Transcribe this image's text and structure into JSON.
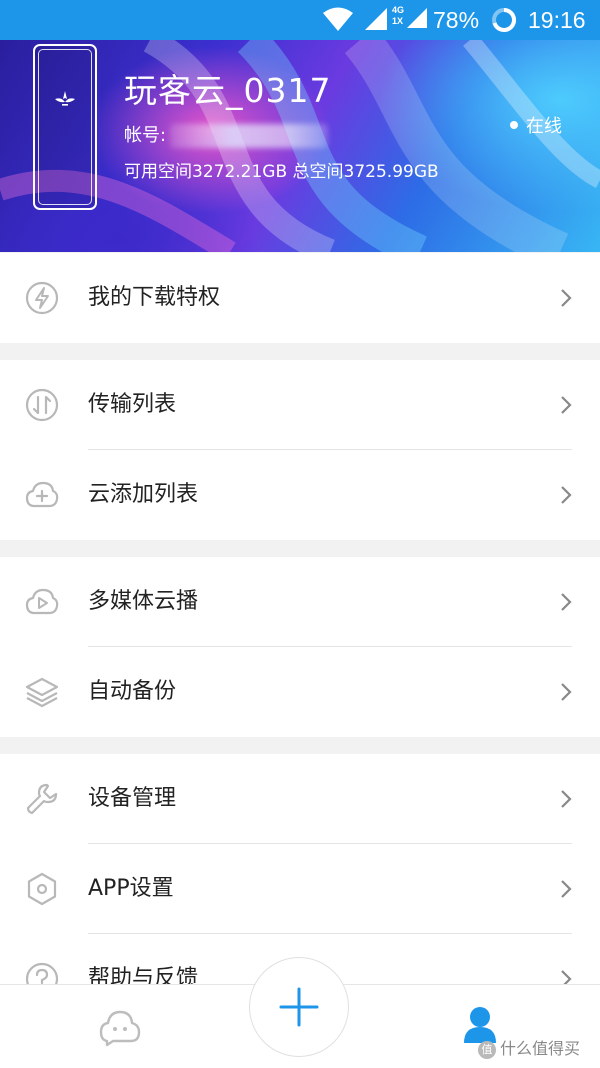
{
  "status_bar": {
    "network_badge_top": "4G",
    "network_badge_bottom": "1X",
    "battery": "78%",
    "time": "19:16"
  },
  "profile": {
    "name": "玩客云_0317",
    "account_label": "帐号: ",
    "storage": "可用空间3272.21GB  总空间3725.99GB",
    "online_status": "在线"
  },
  "menu_groups": [
    {
      "items": [
        {
          "label": "我的下载特权",
          "icon": "lightning-icon"
        }
      ]
    },
    {
      "items": [
        {
          "label": "传输列表",
          "icon": "transfer-icon"
        },
        {
          "label": "云添加列表",
          "icon": "cloud-add-icon"
        }
      ]
    },
    {
      "items": [
        {
          "label": "多媒体云播",
          "icon": "cloud-play-icon"
        },
        {
          "label": "自动备份",
          "icon": "layers-icon"
        }
      ]
    },
    {
      "items": [
        {
          "label": "设备管理",
          "icon": "wrench-icon"
        },
        {
          "label": "APP设置",
          "icon": "settings-hexagon-icon"
        },
        {
          "label": "帮助与反馈",
          "icon": "help-icon"
        }
      ]
    }
  ],
  "tab_bar": {
    "active_tab": "me",
    "accent_color": "#1d96ea"
  },
  "watermark": {
    "badge": "值",
    "text": "什么值得买"
  }
}
